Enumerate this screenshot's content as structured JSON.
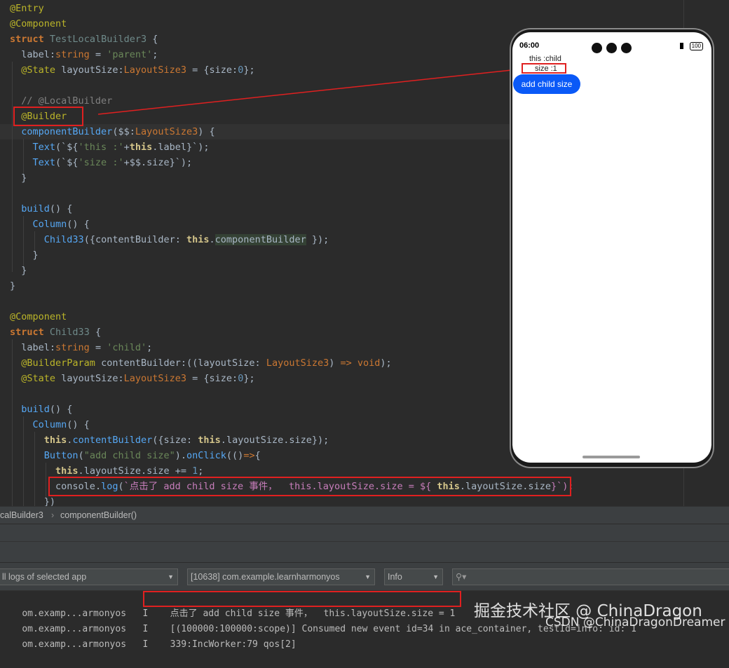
{
  "code": {
    "l1": "@Entry",
    "l2": "@Component",
    "l3_kw": "struct",
    "l3_name": "TestLocalBuilder3",
    "l4_prop": "label",
    "l4_type": "string",
    "l4_val": "'parent'",
    "l5_ann": "@State",
    "l5_prop": "layoutSize",
    "l5_type": "LayoutSize3",
    "l5_key": "size",
    "l5_num": "0",
    "l7_comment": "// @LocalBuilder",
    "l8_ann": "@Builder",
    "l9_fn": "componentBuilder",
    "l9_param": "$$",
    "l9_type": "LayoutSize3",
    "l10_fn": "Text",
    "l10_str": "'this :'",
    "l10_prop": "label",
    "l11_fn": "Text",
    "l11_str": "'size :'",
    "l11_prop": "size",
    "l14_fn": "build",
    "l15_fn": "Column",
    "l16_fn": "Child33",
    "l16_key": "contentBuilder",
    "l16_prop": "componentBuilder",
    "l21_ann": "@Component",
    "l22_kw": "struct",
    "l22_name": "Child33",
    "l23_prop": "label",
    "l23_type": "string",
    "l23_val": "'child'",
    "l24_ann": "@BuilderParam",
    "l24_prop": "contentBuilder",
    "l24_param": "layoutSize",
    "l24_type": "LayoutSize3",
    "l24_void": "void",
    "l25_ann": "@State",
    "l25_prop": "layoutSize",
    "l25_type": "LayoutSize3",
    "l25_key": "size",
    "l25_num": "0",
    "l27_fn": "build",
    "l28_fn": "Column",
    "l29_fn": "contentBuilder",
    "l29_key": "size",
    "l29_prop": "layoutSize.size",
    "l30_fn": "Button",
    "l30_str": "\"add child size\"",
    "l30_on": "onClick",
    "l31_prop": "layoutSize.size",
    "l31_num": "1",
    "l32_obj": "console",
    "l32_fn": "log",
    "l32_str": "`点击了 add child size 事件，  this.layoutSize.size = ${",
    "l32_prop": "layoutSize.size",
    "l32_end": "}`);",
    "this": "this",
    "arrow": "=>",
    "closeparen": "})"
  },
  "phone": {
    "time": "06:00",
    "battery": "100",
    "text1": "this :child",
    "text2": "size :1",
    "button": "add child size"
  },
  "breadcrumb": {
    "item1": "calBuilder3",
    "item2": "componentBuilder()"
  },
  "logcat": {
    "filter_app": "ll logs of selected app",
    "process": "[10638] com.example.learnharmonyos",
    "level": "Info",
    "search_placeholder": "",
    "rows": [
      {
        "tag": "om.examp...armonyos",
        "level": "I",
        "msg": "点击了 add child size 事件，  this.layoutSize.size = 1"
      },
      {
        "tag": "om.examp...armonyos",
        "level": "I",
        "msg": "[(100000:100000:scope)] Consumed new event id=34 in ace_container, testId=info: id: 1"
      },
      {
        "tag": "om.examp...armonyos",
        "level": "I",
        "msg": "339:IncWorker:79 qos[2]"
      }
    ]
  },
  "watermark": {
    "line1": "掘金技术社区 @ ChinaDragon",
    "line2": "CSDN @ChinaDragonDreamer"
  },
  "colors": {
    "editor_bg": "#2b2b2b",
    "highlight_red": "#e02020",
    "button_blue": "#0a59f7"
  }
}
